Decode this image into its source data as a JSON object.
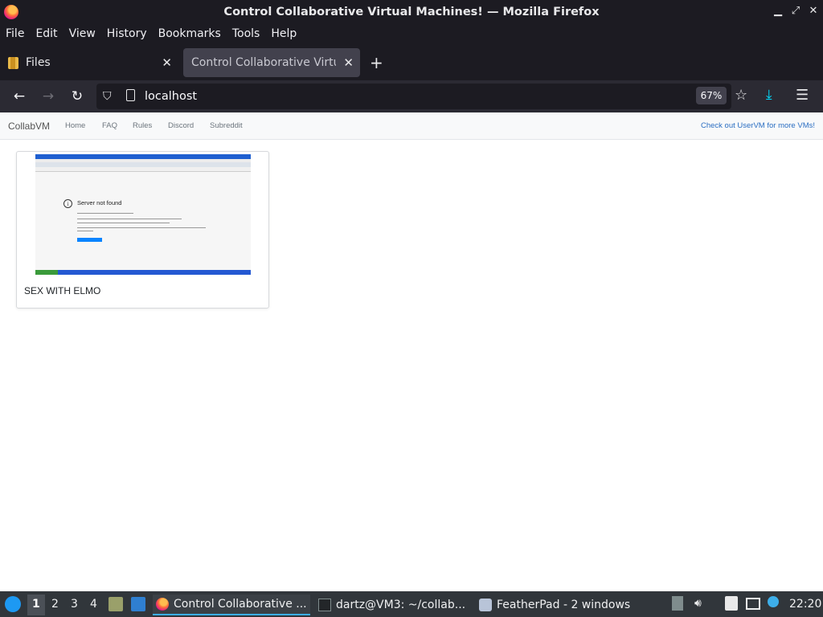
{
  "window": {
    "title": "Control Collaborative Virtual Machines! — Mozilla Firefox"
  },
  "menubar": {
    "items": [
      "File",
      "Edit",
      "View",
      "History",
      "Bookmarks",
      "Tools",
      "Help"
    ]
  },
  "tabs": [
    {
      "label": "Files",
      "icon": "folder-icon"
    },
    {
      "label": "Control Collaborative Virtual Machines!",
      "icon": "",
      "active": true
    }
  ],
  "navbar": {
    "url": "localhost",
    "zoom": "67%"
  },
  "site": {
    "brand": "CollabVM",
    "links": [
      "Home",
      "FAQ",
      "Rules",
      "Discord",
      "Subreddit"
    ],
    "promo": "Check out UserVM for more VMs!"
  },
  "vms": [
    {
      "name": "SEX WITH ELMO",
      "thumbnail": {
        "error_title": "Server not found"
      }
    }
  ],
  "taskbar": {
    "workspaces": [
      "1",
      "2",
      "3",
      "4"
    ],
    "current_workspace": "1",
    "tasks": [
      {
        "label": "Control Collaborative ...",
        "icon": "firefox-icon",
        "active": true
      },
      {
        "label": "dartz@VM3: ~/collab...",
        "icon": "terminal-icon",
        "active": false
      },
      {
        "label": "FeatherPad - 2 windows",
        "icon": "featherpad-icon",
        "active": false
      }
    ],
    "clock": "22:20"
  },
  "colors": {
    "browser_chrome": "#1c1b22",
    "toolbar": "#2b2a33",
    "active_tab": "#42414d",
    "taskbar": "#31363b",
    "accent": "#3daee9",
    "link": "#2a6ec2"
  }
}
